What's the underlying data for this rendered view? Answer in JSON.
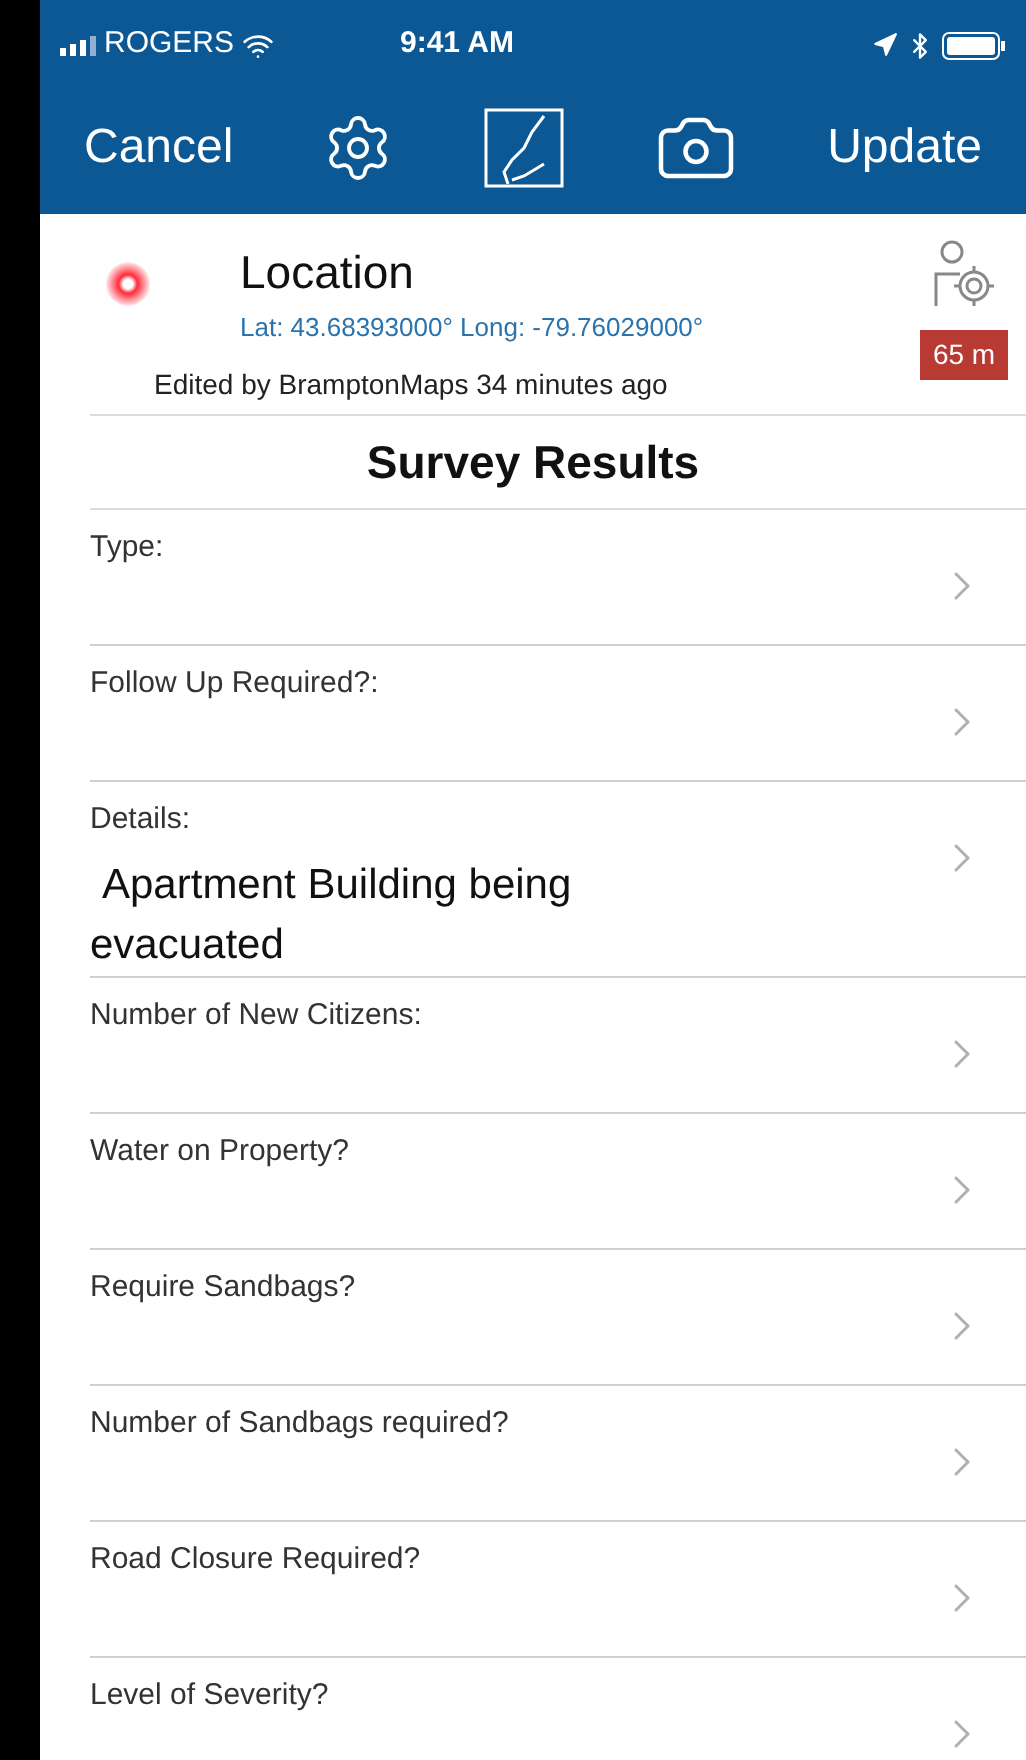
{
  "status_bar": {
    "carrier": "ROGERS",
    "time": "9:41 AM"
  },
  "nav": {
    "cancel": "Cancel",
    "update": "Update"
  },
  "location": {
    "title": "Location",
    "coords": "Lat: 43.68393000° Long: -79.76029000°",
    "edited": "Edited by BramptonMaps 34 minutes ago",
    "accuracy": "65 m"
  },
  "section_title": "Survey Results",
  "fields": [
    {
      "label": "Type:"
    },
    {
      "label": "Follow Up Required?:"
    },
    {
      "label": "Details:",
      "value": "Apartment Building being evacuated"
    },
    {
      "label": "Number of New Citizens:"
    },
    {
      "label": "Water on Property?"
    },
    {
      "label": "Require Sandbags?"
    },
    {
      "label": "Number of Sandbags required?"
    },
    {
      "label": "Road Closure Required?"
    },
    {
      "label": "Level of Severity?"
    }
  ]
}
